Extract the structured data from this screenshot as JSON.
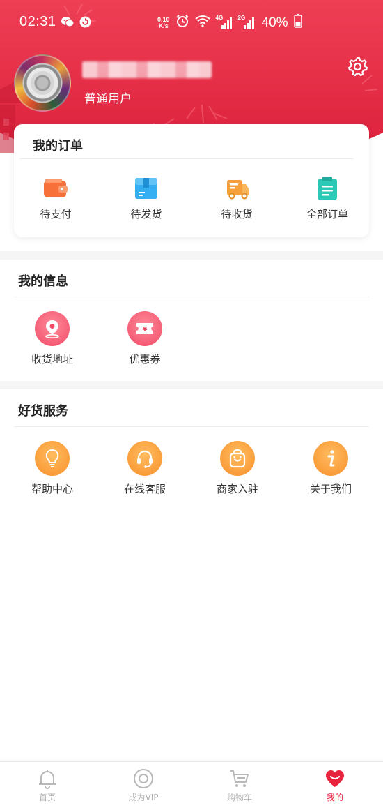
{
  "status_bar": {
    "time": "02:31",
    "net_speed_value": "0.10",
    "net_speed_unit": "K/s",
    "signal_1": "4G",
    "signal_2": "2G",
    "battery": "40%"
  },
  "profile": {
    "user_level": "普通用户"
  },
  "orders": {
    "title": "我的订单",
    "items": [
      {
        "label": "待支付",
        "icon": "wallet-icon"
      },
      {
        "label": "待发货",
        "icon": "box-icon"
      },
      {
        "label": "待收货",
        "icon": "truck-icon"
      },
      {
        "label": "全部订单",
        "icon": "clipboard-icon"
      }
    ]
  },
  "my_info": {
    "title": "我的信息",
    "items": [
      {
        "label": "收货地址",
        "icon": "location-pin-icon"
      },
      {
        "label": "优惠券",
        "icon": "coupon-icon"
      }
    ]
  },
  "services": {
    "title": "好货服务",
    "items": [
      {
        "label": "帮助中心",
        "icon": "lightbulb-icon"
      },
      {
        "label": "在线客服",
        "icon": "headset-icon"
      },
      {
        "label": "商家入驻",
        "icon": "shopping-bag-icon"
      },
      {
        "label": "关于我们",
        "icon": "info-icon"
      }
    ]
  },
  "bottom_nav": {
    "items": [
      {
        "label": "首页",
        "icon": "bell-icon",
        "active": false
      },
      {
        "label": "成为VIP",
        "icon": "vip-circle-icon",
        "active": false
      },
      {
        "label": "购物车",
        "icon": "cart-icon",
        "active": false
      },
      {
        "label": "我的",
        "icon": "heart-icon",
        "active": true
      }
    ]
  },
  "colors": {
    "header_red": "#e52e48",
    "accent_red": "#e8233e",
    "orange_icon": "#f8902a",
    "pink_icon": "#f04a66",
    "teal_icon": "#26c6b8",
    "blue_icon": "#2ea8f0"
  }
}
